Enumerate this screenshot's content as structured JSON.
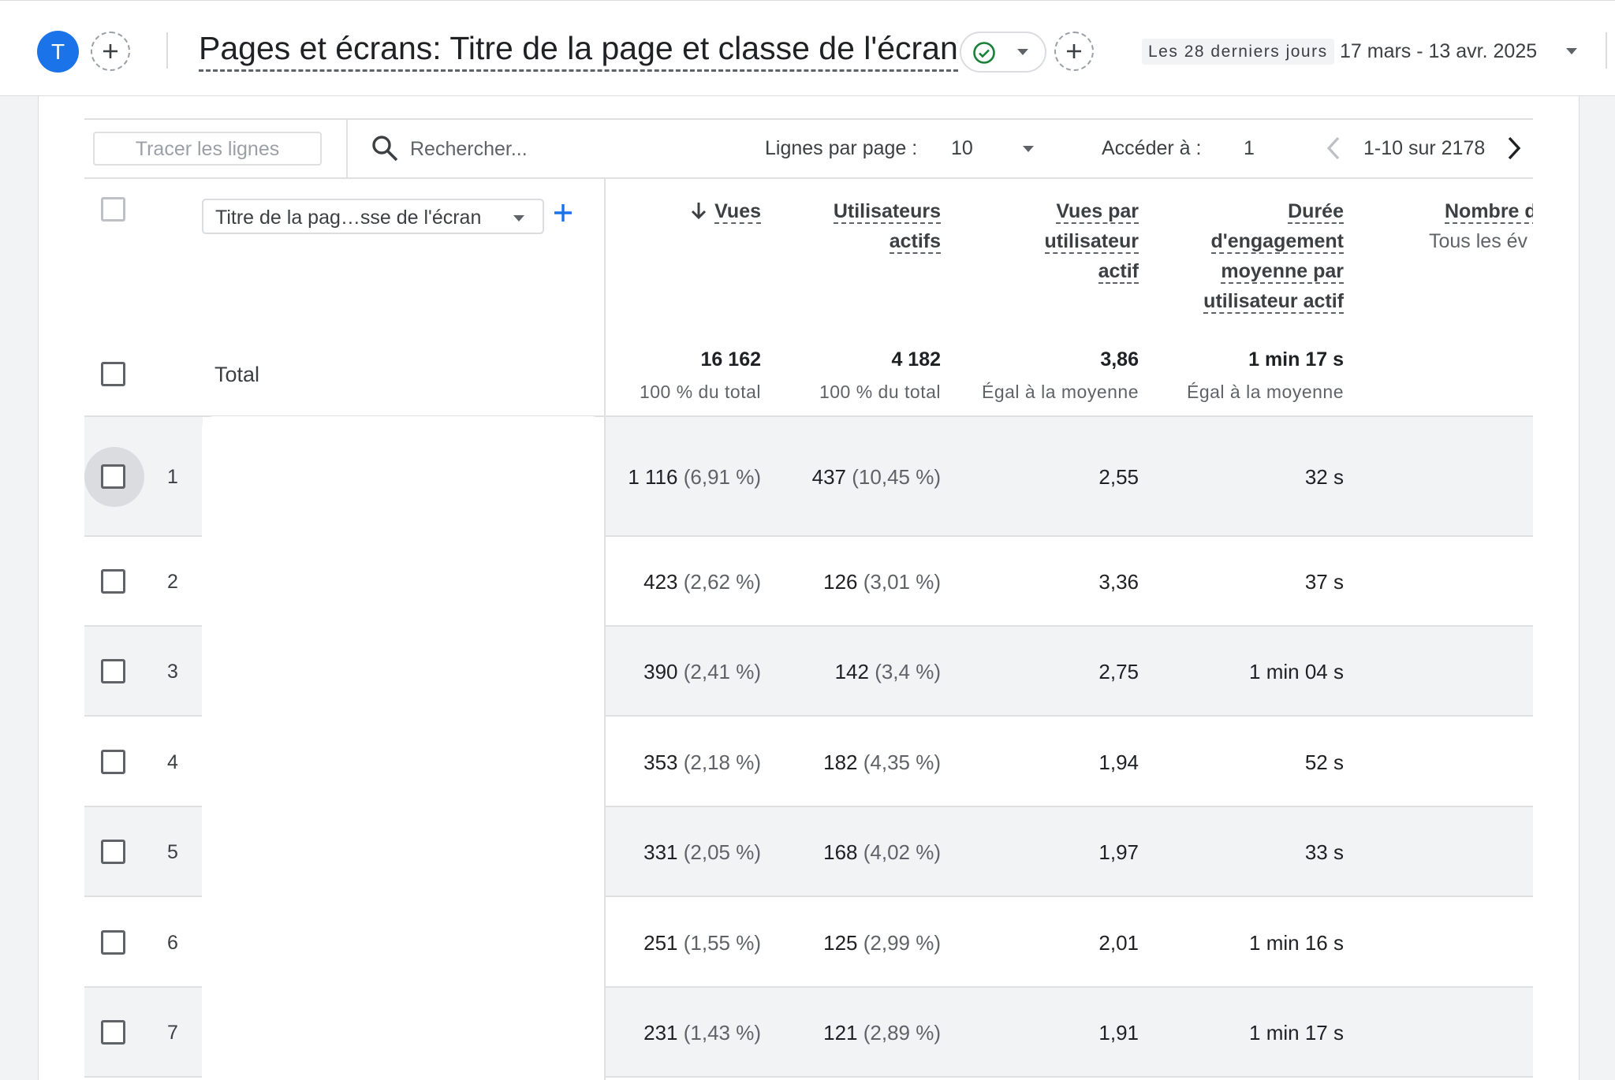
{
  "header": {
    "avatar_letter": "T",
    "page_title": "Pages et écrans: Titre de la page et classe de l'écran",
    "date_badge": "Les 28 derniers jours",
    "date_range": "17 mars - 13 avr. 2025"
  },
  "toolbar": {
    "plot_rows_label": "Tracer les lignes",
    "search_placeholder": "Rechercher...",
    "rows_per_page_label": "Lignes par page :",
    "rows_per_page_value": "10",
    "goto_label": "Accéder à :",
    "goto_value": "1",
    "pagination_text": "1-10 sur 2178"
  },
  "dimension": {
    "selector_label": "Titre de la pag…sse de l'écran",
    "total_label": "Total"
  },
  "columns": [
    {
      "lines": [
        "Vues"
      ],
      "total": "16 162",
      "total_sub": "100 % du total",
      "sorted": true
    },
    {
      "lines": [
        "Utilisateurs",
        "actifs"
      ],
      "total": "4 182",
      "total_sub": "100 % du total"
    },
    {
      "lines": [
        "Vues par",
        "utilisateur",
        "actif"
      ],
      "total": "3,86",
      "total_sub": "Égal à la moyenne"
    },
    {
      "lines": [
        "Durée",
        "d'engagement",
        "moyenne par",
        "utilisateur actif"
      ],
      "total": "1 min 17 s",
      "total_sub": "Égal à la moyenne"
    },
    {
      "lines": [
        "Nombre d"
      ],
      "sub": "Tous les év"
    }
  ],
  "rows": [
    {
      "idx": "1",
      "views": "1 116",
      "views_pct": "(6,91 %)",
      "users": "437",
      "users_pct": "(10,45 %)",
      "vpu": "2,55",
      "dur": "32 s"
    },
    {
      "idx": "2",
      "views": "423",
      "views_pct": "(2,62 %)",
      "users": "126",
      "users_pct": "(3,01 %)",
      "vpu": "3,36",
      "dur": "37 s"
    },
    {
      "idx": "3",
      "views": "390",
      "views_pct": "(2,41 %)",
      "users": "142",
      "users_pct": "(3,4 %)",
      "vpu": "2,75",
      "dur": "1 min 04 s"
    },
    {
      "idx": "4",
      "views": "353",
      "views_pct": "(2,18 %)",
      "users": "182",
      "users_pct": "(4,35 %)",
      "vpu": "1,94",
      "dur": "52 s"
    },
    {
      "idx": "5",
      "views": "331",
      "views_pct": "(2,05 %)",
      "users": "168",
      "users_pct": "(4,02 %)",
      "vpu": "1,97",
      "dur": "33 s"
    },
    {
      "idx": "6",
      "views": "251",
      "views_pct": "(1,55 %)",
      "users": "125",
      "users_pct": "(2,99 %)",
      "vpu": "2,01",
      "dur": "1 min 16 s"
    },
    {
      "idx": "7",
      "views": "231",
      "views_pct": "(1,43 %)",
      "users": "121",
      "users_pct": "(2,89 %)",
      "vpu": "1,91",
      "dur": "1 min 17 s"
    }
  ],
  "colors": {
    "accent": "#1a73e8",
    "check": "#188038"
  }
}
